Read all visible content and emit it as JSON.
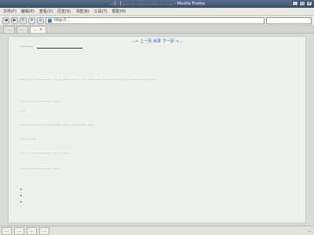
{
  "window": {
    "title": "…:[…] …… … ……… …:… … …… - Mozilla Firefox",
    "buttons": [
      "_",
      "□",
      "×"
    ]
  },
  "menubar": {
    "items": [
      "文件(F)",
      "编辑(E)",
      "查看(V)",
      "历史(S)",
      "书签(B)",
      "工具(T)",
      "帮助(H)"
    ]
  },
  "navbar": {
    "back": "◀",
    "forward": "▶",
    "reload": "↻",
    "stop": "✕",
    "home": "⌂",
    "url": "http://…",
    "search_placeholder": "…"
  },
  "tabs": [
    {
      "label": "…",
      "active": false
    },
    {
      "label": "…",
      "active": false
    },
    {
      "label": "…",
      "active": true
    }
  ],
  "page": {
    "topnav": "…← 上一页 目录 下一页 →…",
    "header": "…:……",
    "paragraphs": [
      "…… …… …… …… ……, …… …… …… …… ……, …… …… …… …… …… ……",
      "…… …… …… …… ……",
      "…:",
      "…… …… …… ……, …… …… …… …… ……",
      "……: ……",
      "…… …… …… …… …… ……",
      "…… …… …… …… ……"
    ],
    "bullets": [
      "•",
      "•",
      "•"
    ]
  },
  "statusbar": {
    "items": [
      "…",
      "…",
      "…",
      "…"
    ],
    "clock": "…"
  }
}
